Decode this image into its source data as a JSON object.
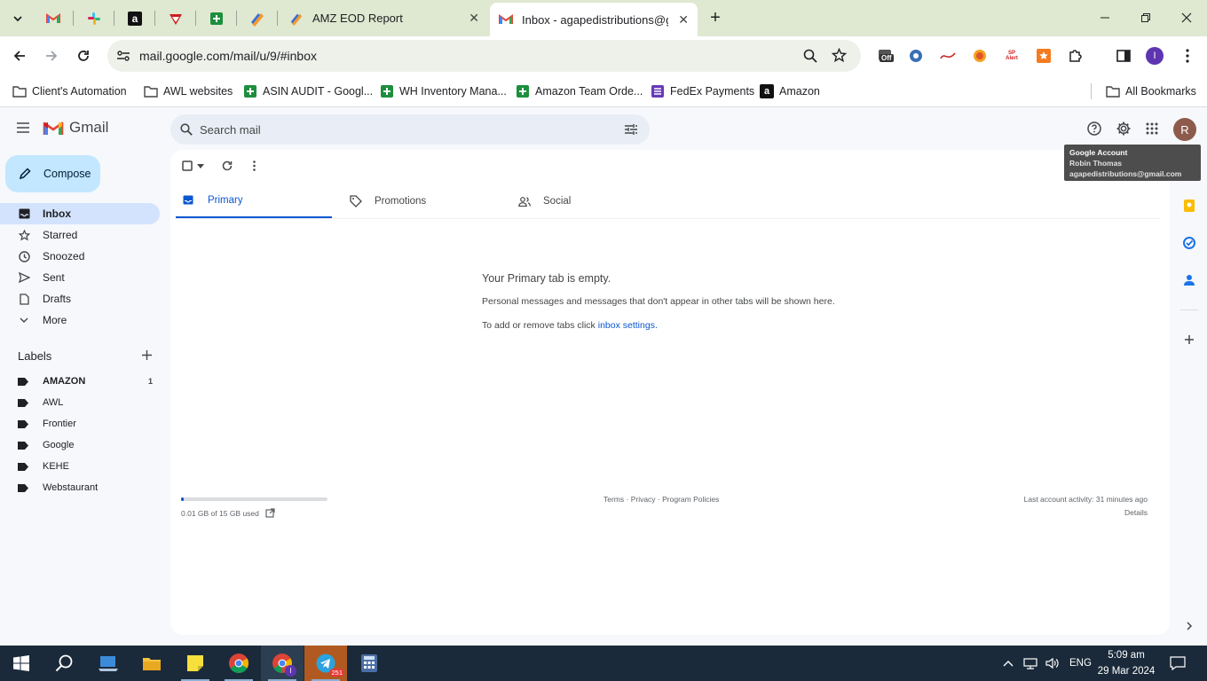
{
  "browser": {
    "tabs": [
      {
        "title": "AMZ EOD Report"
      },
      {
        "title": "Inbox - agapedistributions@gm"
      }
    ],
    "url": "mail.google.com/mail/u/9/#inbox",
    "bookmarks": [
      {
        "label": "Client's Automation",
        "icon": "folder-icon"
      },
      {
        "label": "AWL websites",
        "icon": "folder-icon"
      },
      {
        "label": "ASIN AUDIT - Googl...",
        "icon": "sheets-icon"
      },
      {
        "label": "WH Inventory Mana...",
        "icon": "sheets-icon"
      },
      {
        "label": "Amazon Team Orde...",
        "icon": "sheets-icon"
      },
      {
        "label": "FedEx Payments",
        "icon": "forms-icon"
      },
      {
        "label": "Amazon",
        "icon": "amazon-icon"
      }
    ],
    "all_bookmarks": "All Bookmarks",
    "profile_initial": "I",
    "ext_off_badge": "Off",
    "ext_alert_text": "SP Alert"
  },
  "gmail": {
    "brand": "Gmail",
    "search_placeholder": "Search mail",
    "avatar_initial": "R",
    "compose": "Compose",
    "nav": [
      {
        "label": "Inbox"
      },
      {
        "label": "Starred"
      },
      {
        "label": "Snoozed"
      },
      {
        "label": "Sent"
      },
      {
        "label": "Drafts"
      },
      {
        "label": "More"
      }
    ],
    "labels_heading": "Labels",
    "labels": [
      {
        "name": "AMAZON",
        "count": "1"
      },
      {
        "name": "AWL",
        "count": ""
      },
      {
        "name": "Frontier",
        "count": ""
      },
      {
        "name": "Google",
        "count": ""
      },
      {
        "name": "KEHE",
        "count": ""
      },
      {
        "name": "Webstaurant",
        "count": ""
      }
    ],
    "category_tabs": [
      "Primary",
      "Promotions",
      "Social"
    ],
    "empty": {
      "title": "Your Primary tab is empty.",
      "line1": "Personal messages and messages that don't appear in other tabs will be shown here.",
      "line2_prefix": "To add or remove tabs click ",
      "line2_link": "inbox settings",
      "line2_suffix": "."
    },
    "footer": {
      "storage": "0.01 GB of 15 GB used",
      "storage_fraction": 0.001,
      "links": "Terms · Privacy · Program Policies",
      "activity": "Last account activity: 31 minutes ago",
      "details": "Details"
    },
    "tooltip": {
      "title": "Google Account",
      "name": "Robin Thomas",
      "email": "agapedistributions@gmail.com"
    }
  },
  "taskbar": {
    "language": "ENG",
    "time": "5:09 am",
    "date": "29 Mar 2024",
    "telegram_badge": "251",
    "chrome_profile_initial": "I"
  },
  "colors": {
    "accent_blue": "#0b57d0",
    "compose_bg": "#c2e7ff",
    "active_nav_bg": "#d3e3fd",
    "tabstrip_bg": "#dfe8d0",
    "taskbar_bg": "#1b2a3a"
  }
}
